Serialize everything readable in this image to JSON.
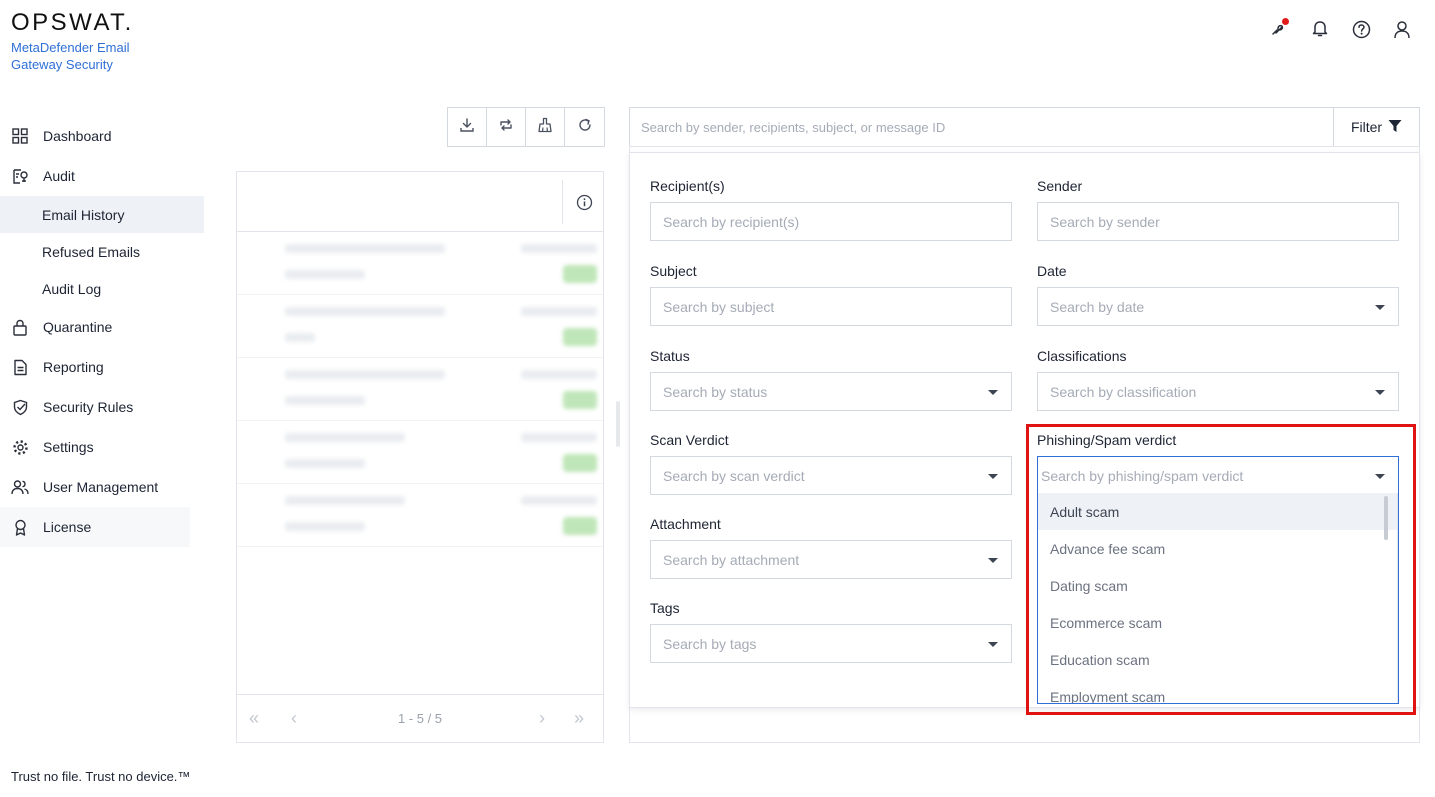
{
  "brand": {
    "logo": "OPSWAT.",
    "product": "MetaDefender Email Gateway Security"
  },
  "header_icons": [
    "pulse-icon",
    "bell-icon",
    "help-icon",
    "user-icon"
  ],
  "sidebar": {
    "items": [
      {
        "label": "Dashboard",
        "icon": "grid-icon"
      },
      {
        "label": "Audit",
        "icon": "audit-icon"
      },
      {
        "label": "Email History",
        "sub": true,
        "active": true
      },
      {
        "label": "Refused Emails",
        "sub": true
      },
      {
        "label": "Audit Log",
        "sub": true
      },
      {
        "label": "Quarantine",
        "icon": "lock-icon"
      },
      {
        "label": "Reporting",
        "icon": "document-icon"
      },
      {
        "label": "Security Rules",
        "icon": "shield-check-icon"
      },
      {
        "label": "Settings",
        "icon": "gear-icon"
      },
      {
        "label": "User Management",
        "icon": "users-icon"
      },
      {
        "label": "License",
        "icon": "award-icon"
      }
    ]
  },
  "footer": "Trust no file. Trust no device.™",
  "toolbar": [
    "download-icon",
    "sync-icon",
    "clean-icon",
    "refresh-icon"
  ],
  "list": {
    "pager_text": "1 - 5 / 5"
  },
  "search": {
    "placeholder": "Search by sender, recipients, subject, or message ID"
  },
  "filter_button": "Filter",
  "filters": {
    "recipients": {
      "label": "Recipient(s)",
      "placeholder": "Search by recipient(s)"
    },
    "sender": {
      "label": "Sender",
      "placeholder": "Search by sender"
    },
    "subject": {
      "label": "Subject",
      "placeholder": "Search by subject"
    },
    "date": {
      "label": "Date",
      "placeholder": "Search by date"
    },
    "status": {
      "label": "Status",
      "placeholder": "Search by status"
    },
    "classifications": {
      "label": "Classifications",
      "placeholder": "Search by classification"
    },
    "scan_verdict": {
      "label": "Scan Verdict",
      "placeholder": "Search by scan verdict"
    },
    "phishing": {
      "label": "Phishing/Spam verdict",
      "placeholder": "Search by phishing/spam verdict"
    },
    "attachment": {
      "label": "Attachment",
      "placeholder": "Search by attachment"
    },
    "tags": {
      "label": "Tags",
      "placeholder": "Search by tags"
    }
  },
  "phishing_options": [
    "Adult scam",
    "Advance fee scam",
    "Dating scam",
    "Ecommerce scam",
    "Education scam",
    "Employment scam"
  ],
  "colors": {
    "accent": "#2f6fd6",
    "highlight": "#e01313",
    "status_green": "#bfe6b8"
  }
}
